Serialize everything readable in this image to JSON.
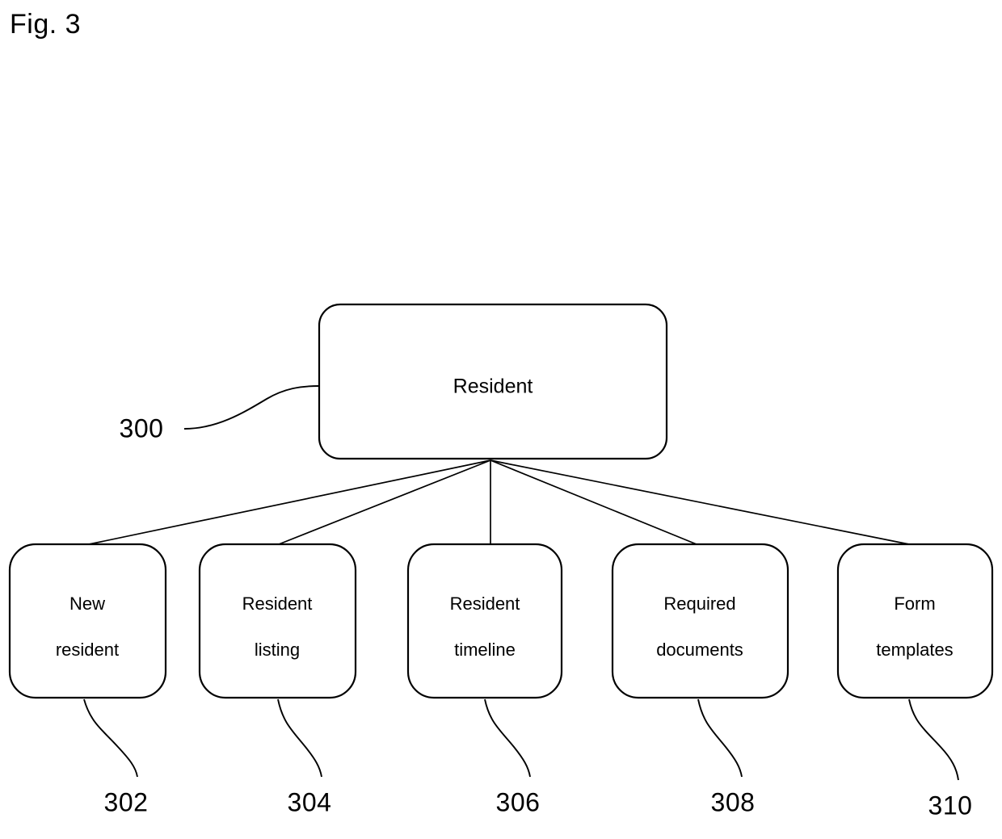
{
  "figure": {
    "label": "Fig. 3",
    "background_color": "#ffffff",
    "line_color": "#000000"
  },
  "root": {
    "label": "Resident",
    "reference": "300"
  },
  "children": [
    {
      "label_line1": "New",
      "label_line2": "resident",
      "reference": "302"
    },
    {
      "label_line1": "Resident",
      "label_line2": "listing",
      "reference": "304"
    },
    {
      "label_line1": "Resident",
      "label_line2": "timeline",
      "reference": "306"
    },
    {
      "label_line1": "Required",
      "label_line2": "documents",
      "reference": "308"
    },
    {
      "label_line1": "Form",
      "label_line2": "templates",
      "reference": "310"
    }
  ]
}
